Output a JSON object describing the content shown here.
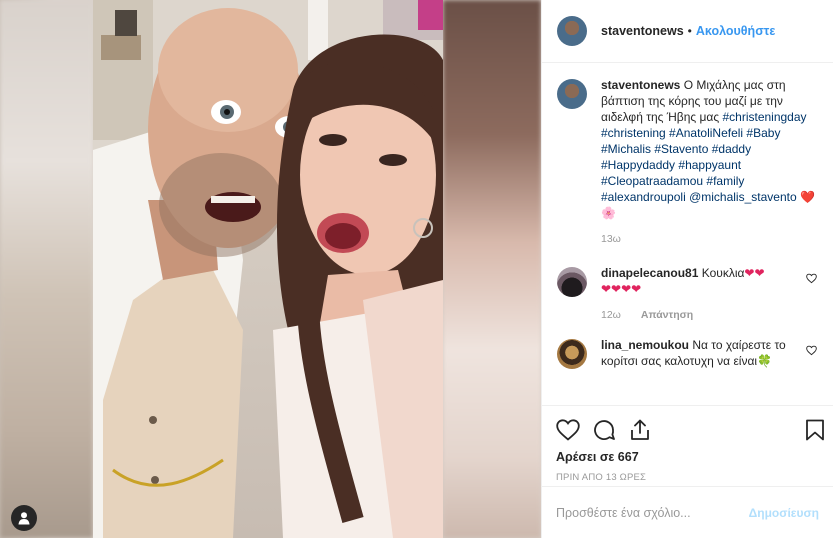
{
  "post": {
    "username": "staventonews",
    "dot": "•",
    "follow_label": "Ακολουθήστε"
  },
  "caption": {
    "username": "staventonews",
    "text": "Ο Μιχάλης μας στη βάπτιση της κόρης του μαζί με την αιδελφή της Ήβης μας",
    "hashtags": "#christeningday #christening #AnatoliNefeli #Baby #Michalis #Stavento #daddy #Happydaddy #happyaunt #Cleopatraadamou #family #alexandroupoli @michalis_stavento",
    "emoji": "❤️ 🌸",
    "age": "13ω"
  },
  "comments": [
    {
      "username": "dinapelecanou81",
      "text": "Κουκλια",
      "emoji_inline": "❤❤",
      "emoji_line": "❤❤❤❤",
      "age": "12ω",
      "reply_label": "Απάντηση"
    },
    {
      "username": "lina_nemoukou",
      "text": "Να το χαίρεστε το κορίτσι σας καλοτυχη να είναι",
      "emoji": "🍀"
    }
  ],
  "likes_text": "Αρέσει σε 667",
  "time_text": "ΠΡΙΝ ΑΠΟ 13 ΩΡΕΣ",
  "add_comment": {
    "placeholder": "Προσθέστε ένα σχόλιο...",
    "post_label": "Δημοσίευση"
  },
  "icons": {
    "tag": "user-tag-icon",
    "like": "heart-outline-icon",
    "comment": "comment-bubble-icon",
    "share": "share-icon",
    "save": "bookmark-icon",
    "comment_like": "small-heart-icon"
  },
  "colors": {
    "link": "#3897f0",
    "hashtag": "#003569",
    "heart": "#e0245e",
    "muted": "#999999",
    "post_disabled": "#b2dffc"
  }
}
